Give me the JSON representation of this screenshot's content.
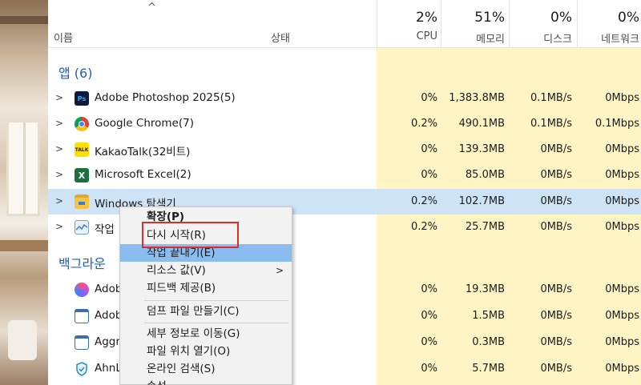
{
  "header": {
    "sort_caret": "^",
    "name_label": "이름",
    "status_label": "상태",
    "cpu": {
      "percent": "2%",
      "label": "CPU"
    },
    "memory": {
      "percent": "51%",
      "label": "메모리"
    },
    "disk": {
      "percent": "0%",
      "label": "디스크"
    },
    "network": {
      "percent": "0%",
      "label": "네트워크"
    }
  },
  "groups": {
    "apps_label": "앱 (6)",
    "background_label": "백그라운"
  },
  "apps": [
    {
      "name": "Adobe Photoshop 2025(5)",
      "icon": "photoshop-icon",
      "icon_text": "Ps",
      "cpu": "0%",
      "memory": "1,383.8MB",
      "disk": "0.1MB/s",
      "network": "0Mbps"
    },
    {
      "name": "Google Chrome(7)",
      "icon": "chrome-icon",
      "icon_text": "",
      "cpu": "0.2%",
      "memory": "490.1MB",
      "disk": "0.1MB/s",
      "network": "0.1Mbps"
    },
    {
      "name": "KakaoTalk(32비트)",
      "icon": "kakaotalk-icon",
      "icon_text": "TALK",
      "cpu": "0%",
      "memory": "139.3MB",
      "disk": "0MB/s",
      "network": "0Mbps"
    },
    {
      "name": "Microsoft Excel(2)",
      "icon": "excel-icon",
      "icon_text": "X",
      "cpu": "0%",
      "memory": "85.0MB",
      "disk": "0MB/s",
      "network": "0Mbps"
    },
    {
      "name": "Windows 탐색기",
      "icon": "file-explorer-icon",
      "icon_text": "",
      "cpu": "0.2%",
      "memory": "102.7MB",
      "disk": "0MB/s",
      "network": "0Mbps"
    },
    {
      "name": "작업",
      "icon": "task-manager-icon",
      "icon_text": "",
      "cpu": "0.2%",
      "memory": "25.7MB",
      "disk": "0MB/s",
      "network": "0Mbps"
    }
  ],
  "background": [
    {
      "name": "Adob",
      "icon": "adobe-app-icon",
      "cpu": "0%",
      "memory": "19.3MB",
      "disk": "0MB/s",
      "network": "0Mbps"
    },
    {
      "name": "Adob",
      "icon": "window-app-icon",
      "cpu": "0%",
      "memory": "1.5MB",
      "disk": "0MB/s",
      "network": "0Mbps"
    },
    {
      "name": "Aggr",
      "icon": "window-app-icon",
      "cpu": "0%",
      "memory": "0.3MB",
      "disk": "0MB/s",
      "network": "0Mbps"
    },
    {
      "name": "AhnL",
      "icon": "shield-icon",
      "cpu": "0%",
      "memory": "5.7MB",
      "disk": "0MB/s",
      "network": "0Mbps"
    }
  ],
  "context_menu": {
    "expand": "확장(P)",
    "restart": "다시 시작(R)",
    "end_task": "작업 끝내기(E)",
    "resource_values": "리소스 값(V)",
    "feedback": "피드백 제공(B)",
    "dump_file": "덤프 파일 만들기(C)",
    "go_to_details": "세부 정보로 이동(G)",
    "open_file_location": "파일 위치 열기(O)",
    "search_online": "온라인 검색(S)",
    "properties": "속성"
  },
  "colors": {
    "heat_light": "#fff4c4",
    "heat_mid": "#fde7a3",
    "selected_row": "#cfe3f7",
    "menu_hover": "#8bbcef",
    "annotation_red": "#e02b2b",
    "group_blue": "#1f5fb3"
  }
}
